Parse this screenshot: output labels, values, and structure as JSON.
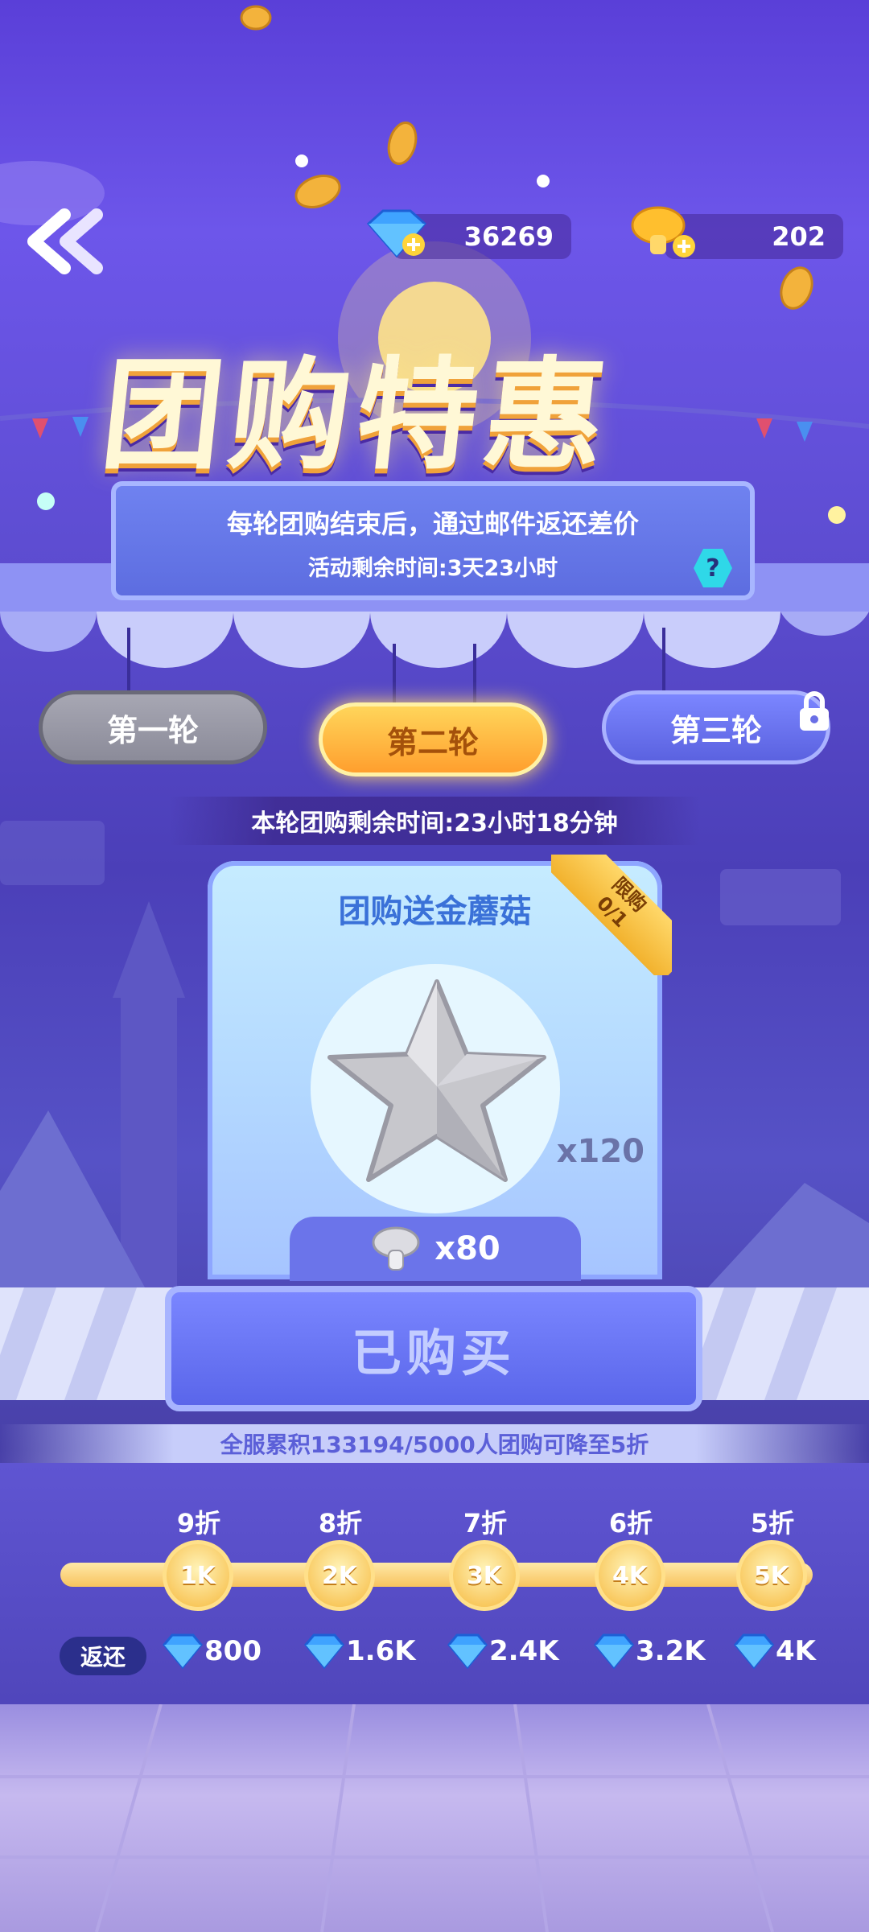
{
  "header": {
    "gems": "36269",
    "mushrooms": "202"
  },
  "title": "团购特惠",
  "info": {
    "line1": "每轮团购结束后，通过邮件返还差价",
    "line2": "活动剩余时间:3天23小时",
    "help": "?"
  },
  "rounds": [
    {
      "label": "第一轮",
      "state": "done"
    },
    {
      "label": "第二轮",
      "state": "active"
    },
    {
      "label": "第三轮",
      "state": "locked"
    }
  ],
  "round_timer": "本轮团购剩余时间:23小时18分钟",
  "card": {
    "title": "团购送金蘑菇",
    "limit_label": "限购",
    "limit_value": "0/1",
    "item_qty": "x120",
    "price": "x80"
  },
  "buy_button": "已购买",
  "progress_text": "全服累积133194/5000人团购可降至5折",
  "tiers": [
    {
      "discount": "9折",
      "node": "1K",
      "reward": "800"
    },
    {
      "discount": "8折",
      "node": "2K",
      "reward": "1.6K"
    },
    {
      "discount": "7折",
      "node": "3K",
      "reward": "2.4K"
    },
    {
      "discount": "6折",
      "node": "4K",
      "reward": "3.2K"
    },
    {
      "discount": "5折",
      "node": "5K",
      "reward": "4K"
    }
  ],
  "refund_label": "返还",
  "colors": {
    "accent_gold": "#f7c35e",
    "active_round": "#ffb13c",
    "panel_blue": "#6a76f2"
  }
}
